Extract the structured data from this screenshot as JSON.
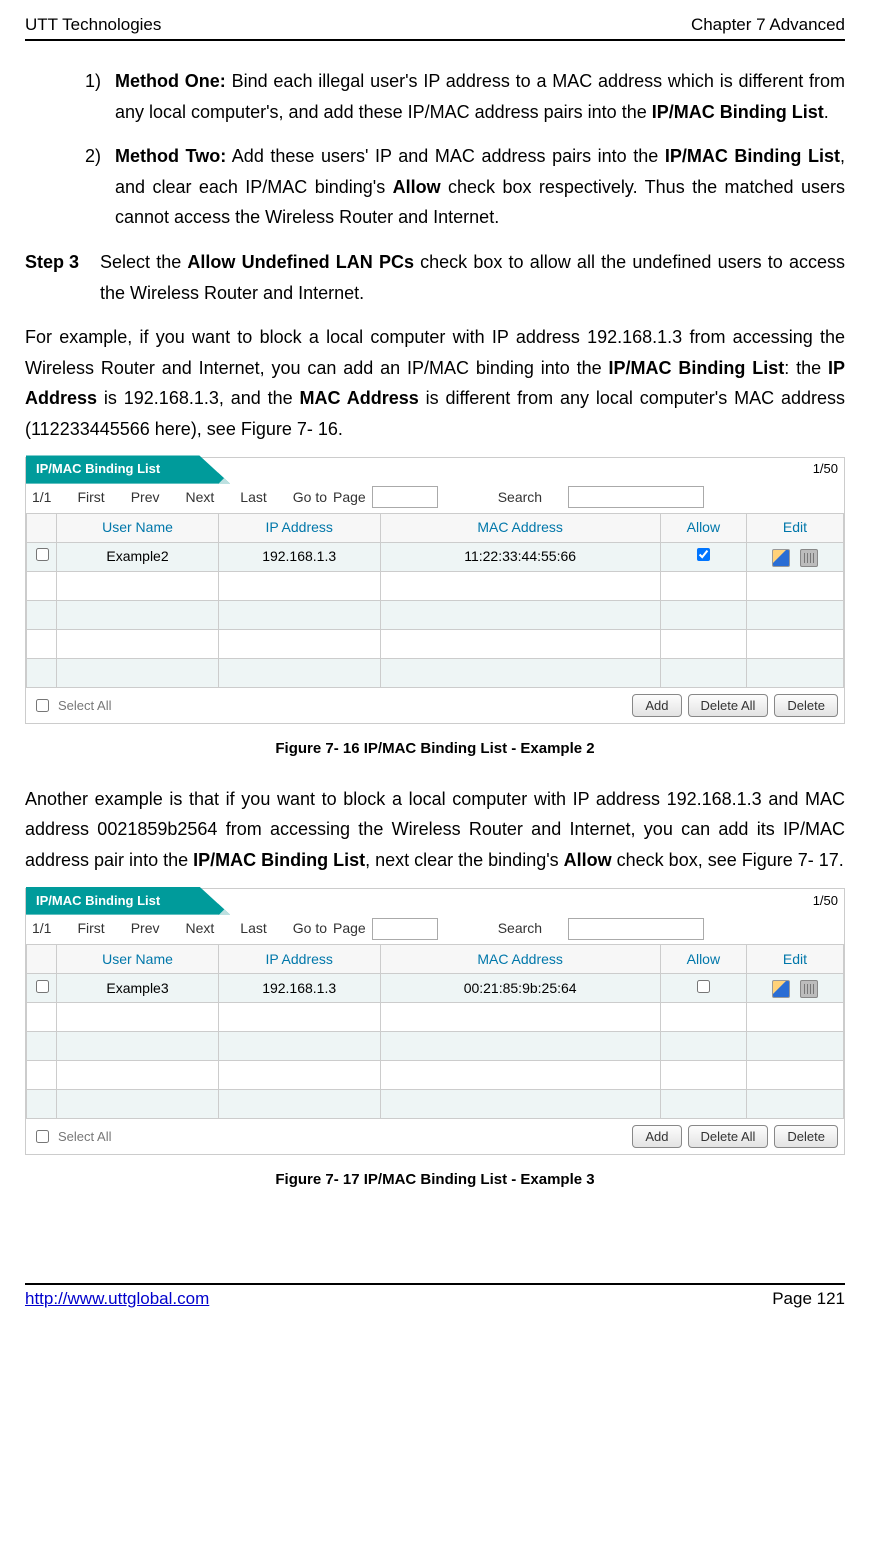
{
  "header": {
    "left": "UTT Technologies",
    "right": "Chapter 7 Advanced"
  },
  "methods": {
    "m1_num": "1)",
    "m1_label": "Method One:",
    "m1_text": " Bind each illegal user's IP address to a MAC address which is different from any local computer's, and add these IP/MAC address pairs into the ",
    "m1_bold_tail": "IP/MAC Binding List",
    "m1_tail": ".",
    "m2_num": "2)",
    "m2_label": "Method Two:",
    "m2_text_a": " Add these users' IP and MAC address pairs into the ",
    "m2_bold_a": "IP/MAC Binding List",
    "m2_text_b": ", and clear each IP/MAC binding's ",
    "m2_bold_b": "Allow",
    "m2_text_c": " check box respectively. Thus the matched users cannot access the Wireless Router and Internet."
  },
  "step3": {
    "label": "Step 3",
    "text_a": "Select the ",
    "bold_a": "Allow Undefined LAN PCs",
    "text_b": " check box to allow all the undefined users to access the Wireless Router and Internet."
  },
  "para1": {
    "a": "For example, if you want to block a local computer with IP address 192.168.1.3 from accessing the Wireless Router and Internet, you can add an IP/MAC binding into the ",
    "b": "IP/MAC Binding List",
    "c": ": the ",
    "d": "IP Address",
    "e": " is 192.168.1.3, and the ",
    "f": "MAC Address",
    "g": " is different from any local computer's MAC address (112233445566 here), see Figure 7- 16."
  },
  "para2": {
    "a": "Another example is that if you want to block a local computer with IP address 192.168.1.3 and MAC address 0021859b2564 from accessing the Wireless Router and Internet, you can add its IP/MAC address pair into the ",
    "b": "IP/MAC Binding List",
    "c": ", next clear the binding's ",
    "d": "Allow",
    "e": " check box, see Figure 7- 17."
  },
  "widget": {
    "tab_title": "IP/MAC Binding List",
    "page_count": "1/50",
    "nav": {
      "pos": "1/1",
      "first": "First",
      "prev": "Prev",
      "next": "Next",
      "last": "Last",
      "goto": "Go to",
      "page": "Page",
      "search": "Search"
    },
    "cols": {
      "user": "User Name",
      "ip": "IP Address",
      "mac": "MAC Address",
      "allow": "Allow",
      "edit": "Edit"
    },
    "select_all": "Select All",
    "btn_add": "Add",
    "btn_delall": "Delete All",
    "btn_del": "Delete"
  },
  "fig1": {
    "row": {
      "user": "Example2",
      "ip": "192.168.1.3",
      "mac": "11:22:33:44:55:66",
      "allow_checked": true
    },
    "caption": "Figure 7- 16 IP/MAC Binding List - Example 2"
  },
  "fig2": {
    "row": {
      "user": "Example3",
      "ip": "192.168.1.3",
      "mac": "00:21:85:9b:25:64",
      "allow_checked": false
    },
    "caption": "Figure 7- 17 IP/MAC Binding List - Example 3"
  },
  "footer": {
    "url": "http://www.uttglobal.com",
    "page": "Page 121"
  }
}
